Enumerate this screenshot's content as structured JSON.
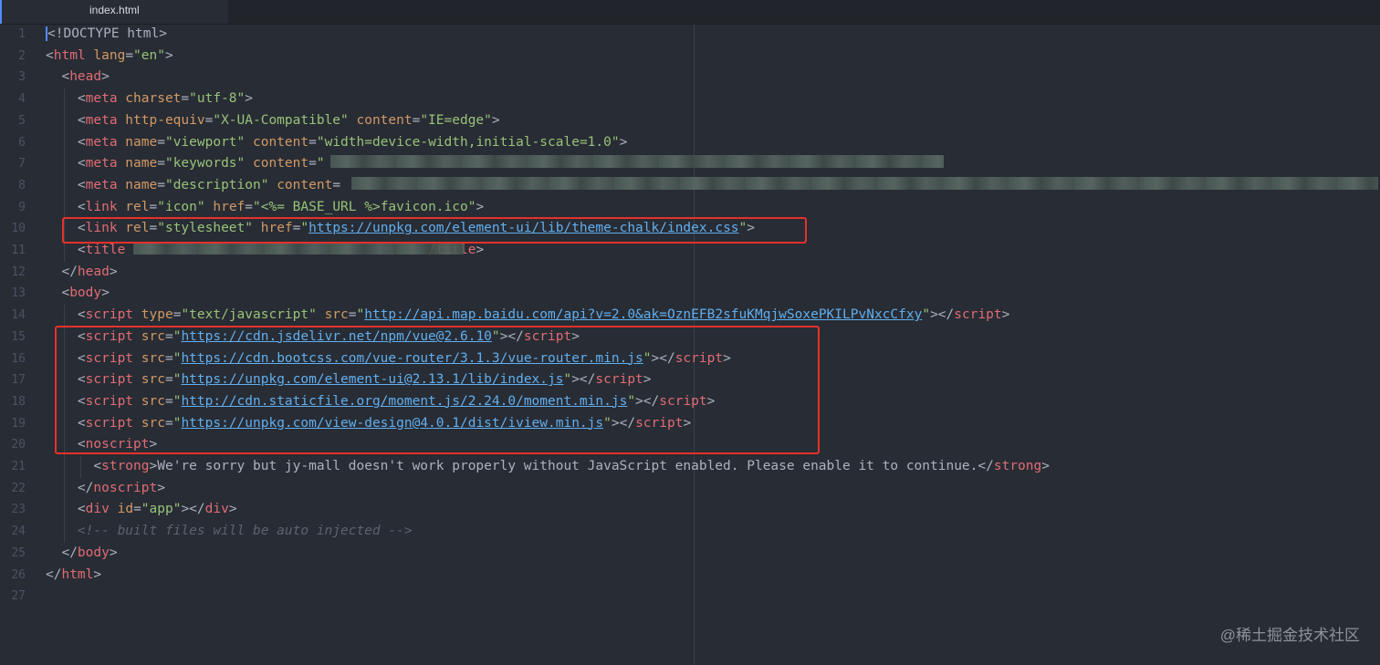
{
  "tab": {
    "filename": "index.html"
  },
  "lines": [
    {
      "n": "1",
      "tokens": [
        {
          "t": "<",
          "c": "t-punc t-cur"
        },
        {
          "t": "!DOCTYPE html",
          "c": "t-punc"
        },
        {
          "t": ">",
          "c": "t-punc"
        }
      ]
    },
    {
      "n": "2",
      "tokens": [
        {
          "t": "<",
          "c": "t-punc"
        },
        {
          "t": "html",
          "c": "t-tag"
        },
        {
          "t": " lang",
          "c": "t-attr"
        },
        {
          "t": "=",
          "c": "t-punc"
        },
        {
          "t": "\"en\"",
          "c": "t-str"
        },
        {
          "t": ">",
          "c": "t-punc"
        }
      ]
    },
    {
      "n": "3",
      "tokens": [
        {
          "t": "  <",
          "c": "t-punc"
        },
        {
          "t": "head",
          "c": "t-tag"
        },
        {
          "t": ">",
          "c": "t-punc"
        }
      ]
    },
    {
      "n": "4",
      "tokens": [
        {
          "t": "    <",
          "c": "t-punc"
        },
        {
          "t": "meta",
          "c": "t-tag"
        },
        {
          "t": " charset",
          "c": "t-attr"
        },
        {
          "t": "=",
          "c": "t-punc"
        },
        {
          "t": "\"utf-8\"",
          "c": "t-str"
        },
        {
          "t": ">",
          "c": "t-punc"
        }
      ]
    },
    {
      "n": "5",
      "tokens": [
        {
          "t": "    <",
          "c": "t-punc"
        },
        {
          "t": "meta",
          "c": "t-tag"
        },
        {
          "t": " http-equiv",
          "c": "t-attr"
        },
        {
          "t": "=",
          "c": "t-punc"
        },
        {
          "t": "\"X-UA-Compatible\"",
          "c": "t-str"
        },
        {
          "t": " content",
          "c": "t-attr"
        },
        {
          "t": "=",
          "c": "t-punc"
        },
        {
          "t": "\"IE=edge\"",
          "c": "t-str"
        },
        {
          "t": ">",
          "c": "t-punc"
        }
      ]
    },
    {
      "n": "6",
      "tokens": [
        {
          "t": "    <",
          "c": "t-punc"
        },
        {
          "t": "meta",
          "c": "t-tag"
        },
        {
          "t": " name",
          "c": "t-attr"
        },
        {
          "t": "=",
          "c": "t-punc"
        },
        {
          "t": "\"viewport\"",
          "c": "t-str"
        },
        {
          "t": " content",
          "c": "t-attr"
        },
        {
          "t": "=",
          "c": "t-punc"
        },
        {
          "t": "\"width=device-width,initial-scale=1.0\"",
          "c": "t-str"
        },
        {
          "t": ">",
          "c": "t-punc"
        }
      ]
    },
    {
      "n": "7",
      "tokens": [
        {
          "t": "    <",
          "c": "t-punc"
        },
        {
          "t": "meta",
          "c": "t-tag"
        },
        {
          "t": " name",
          "c": "t-attr"
        },
        {
          "t": "=",
          "c": "t-punc"
        },
        {
          "t": "\"keywords\"",
          "c": "t-str"
        },
        {
          "t": " content",
          "c": "t-attr"
        },
        {
          "t": "=",
          "c": "t-punc"
        },
        {
          "t": "\"",
          "c": "t-str"
        }
      ]
    },
    {
      "n": "8",
      "tokens": [
        {
          "t": "    <",
          "c": "t-punc"
        },
        {
          "t": "meta",
          "c": "t-tag"
        },
        {
          "t": " name",
          "c": "t-attr"
        },
        {
          "t": "=",
          "c": "t-punc"
        },
        {
          "t": "\"description\"",
          "c": "t-str"
        },
        {
          "t": " content",
          "c": "t-attr"
        },
        {
          "t": "=",
          "c": "t-punc"
        }
      ]
    },
    {
      "n": "9",
      "tokens": [
        {
          "t": "    <",
          "c": "t-punc"
        },
        {
          "t": "link",
          "c": "t-tag"
        },
        {
          "t": " rel",
          "c": "t-attr"
        },
        {
          "t": "=",
          "c": "t-punc"
        },
        {
          "t": "\"icon\"",
          "c": "t-str"
        },
        {
          "t": " href",
          "c": "t-attr"
        },
        {
          "t": "=",
          "c": "t-punc"
        },
        {
          "t": "\"<%= BASE_URL %>favicon.ico\"",
          "c": "t-str"
        },
        {
          "t": ">",
          "c": "t-punc"
        }
      ]
    },
    {
      "n": "10",
      "tokens": [
        {
          "t": "    <",
          "c": "t-punc"
        },
        {
          "t": "link",
          "c": "t-tag"
        },
        {
          "t": " rel",
          "c": "t-attr"
        },
        {
          "t": "=",
          "c": "t-punc"
        },
        {
          "t": "\"stylesheet\"",
          "c": "t-str"
        },
        {
          "t": " href",
          "c": "t-attr"
        },
        {
          "t": "=",
          "c": "t-punc"
        },
        {
          "t": "\"",
          "c": "t-str"
        },
        {
          "t": "https://unpkg.com/element-ui/lib/theme-chalk/index.css",
          "c": "t-link"
        },
        {
          "t": "\"",
          "c": "t-str"
        },
        {
          "t": ">",
          "c": "t-punc"
        }
      ]
    },
    {
      "n": "11",
      "tokens": [
        {
          "t": "    <",
          "c": "t-punc"
        },
        {
          "t": "title",
          "c": "t-tag"
        },
        {
          "t": "                                      ",
          "c": "t-punc"
        },
        {
          "t": "/title",
          "c": "t-tag"
        },
        {
          "t": ">",
          "c": "t-punc"
        }
      ]
    },
    {
      "n": "12",
      "tokens": [
        {
          "t": "  </",
          "c": "t-punc"
        },
        {
          "t": "head",
          "c": "t-tag"
        },
        {
          "t": ">",
          "c": "t-punc"
        }
      ]
    },
    {
      "n": "13",
      "tokens": [
        {
          "t": "  <",
          "c": "t-punc"
        },
        {
          "t": "body",
          "c": "t-tag"
        },
        {
          "t": ">",
          "c": "t-punc"
        }
      ]
    },
    {
      "n": "14",
      "tokens": [
        {
          "t": "    <",
          "c": "t-punc"
        },
        {
          "t": "script",
          "c": "t-tag"
        },
        {
          "t": " type",
          "c": "t-attr"
        },
        {
          "t": "=",
          "c": "t-punc"
        },
        {
          "t": "\"text/javascript\"",
          "c": "t-str"
        },
        {
          "t": " src",
          "c": "t-attr"
        },
        {
          "t": "=",
          "c": "t-punc"
        },
        {
          "t": "\"",
          "c": "t-str"
        },
        {
          "t": "http://api.map.baidu.com/api?v=2.0&ak=OznEFB2sfuKMqjwSoxePKILPvNxcCfxy",
          "c": "t-link"
        },
        {
          "t": "\"",
          "c": "t-str"
        },
        {
          "t": "></",
          "c": "t-punc"
        },
        {
          "t": "script",
          "c": "t-tag"
        },
        {
          "t": ">",
          "c": "t-punc"
        }
      ]
    },
    {
      "n": "15",
      "tokens": [
        {
          "t": "    <",
          "c": "t-punc"
        },
        {
          "t": "script",
          "c": "t-tag"
        },
        {
          "t": " src",
          "c": "t-attr"
        },
        {
          "t": "=",
          "c": "t-punc"
        },
        {
          "t": "\"",
          "c": "t-str"
        },
        {
          "t": "https://cdn.jsdelivr.net/npm/vue@2.6.10",
          "c": "t-link"
        },
        {
          "t": "\"",
          "c": "t-str"
        },
        {
          "t": "></",
          "c": "t-punc"
        },
        {
          "t": "script",
          "c": "t-tag"
        },
        {
          "t": ">",
          "c": "t-punc"
        }
      ]
    },
    {
      "n": "16",
      "tokens": [
        {
          "t": "    <",
          "c": "t-punc"
        },
        {
          "t": "script",
          "c": "t-tag"
        },
        {
          "t": " src",
          "c": "t-attr"
        },
        {
          "t": "=",
          "c": "t-punc"
        },
        {
          "t": "\"",
          "c": "t-str"
        },
        {
          "t": "https://cdn.bootcss.com/vue-router/3.1.3/vue-router.min.js",
          "c": "t-link"
        },
        {
          "t": "\"",
          "c": "t-str"
        },
        {
          "t": "></",
          "c": "t-punc"
        },
        {
          "t": "script",
          "c": "t-tag"
        },
        {
          "t": ">",
          "c": "t-punc"
        }
      ]
    },
    {
      "n": "17",
      "tokens": [
        {
          "t": "    <",
          "c": "t-punc"
        },
        {
          "t": "script",
          "c": "t-tag"
        },
        {
          "t": " src",
          "c": "t-attr"
        },
        {
          "t": "=",
          "c": "t-punc"
        },
        {
          "t": "\"",
          "c": "t-str"
        },
        {
          "t": "https://unpkg.com/element-ui@2.13.1/lib/index.js",
          "c": "t-link"
        },
        {
          "t": "\"",
          "c": "t-str"
        },
        {
          "t": "></",
          "c": "t-punc"
        },
        {
          "t": "script",
          "c": "t-tag"
        },
        {
          "t": ">",
          "c": "t-punc"
        }
      ]
    },
    {
      "n": "18",
      "tokens": [
        {
          "t": "    <",
          "c": "t-punc"
        },
        {
          "t": "script",
          "c": "t-tag"
        },
        {
          "t": " src",
          "c": "t-attr"
        },
        {
          "t": "=",
          "c": "t-punc"
        },
        {
          "t": "\"",
          "c": "t-str"
        },
        {
          "t": "http://cdn.staticfile.org/moment.js/2.24.0/moment.min.js",
          "c": "t-link"
        },
        {
          "t": "\"",
          "c": "t-str"
        },
        {
          "t": "></",
          "c": "t-punc"
        },
        {
          "t": "script",
          "c": "t-tag"
        },
        {
          "t": ">",
          "c": "t-punc"
        }
      ]
    },
    {
      "n": "19",
      "tokens": [
        {
          "t": "    <",
          "c": "t-punc"
        },
        {
          "t": "script",
          "c": "t-tag"
        },
        {
          "t": " src",
          "c": "t-attr"
        },
        {
          "t": "=",
          "c": "t-punc"
        },
        {
          "t": "\"",
          "c": "t-str"
        },
        {
          "t": "https://unpkg.com/view-design@4.0.1/dist/iview.min.js",
          "c": "t-link"
        },
        {
          "t": "\"",
          "c": "t-str"
        },
        {
          "t": "></",
          "c": "t-punc"
        },
        {
          "t": "script",
          "c": "t-tag"
        },
        {
          "t": ">",
          "c": "t-punc"
        }
      ]
    },
    {
      "n": "20",
      "tokens": [
        {
          "t": "    <",
          "c": "t-punc"
        },
        {
          "t": "noscript",
          "c": "t-tag"
        },
        {
          "t": ">",
          "c": "t-punc"
        }
      ]
    },
    {
      "n": "21",
      "tokens": [
        {
          "t": "      <",
          "c": "t-punc"
        },
        {
          "t": "strong",
          "c": "t-tag"
        },
        {
          "t": ">We're sorry but jy-mall doesn't work properly without JavaScript enabled. Please enable it to continue.</",
          "c": "t-punc"
        },
        {
          "t": "strong",
          "c": "t-tag"
        },
        {
          "t": ">",
          "c": "t-punc"
        }
      ]
    },
    {
      "n": "22",
      "tokens": [
        {
          "t": "    </",
          "c": "t-punc"
        },
        {
          "t": "noscript",
          "c": "t-tag"
        },
        {
          "t": ">",
          "c": "t-punc"
        }
      ]
    },
    {
      "n": "23",
      "tokens": [
        {
          "t": "    <",
          "c": "t-punc"
        },
        {
          "t": "div",
          "c": "t-tag"
        },
        {
          "t": " id",
          "c": "t-attr"
        },
        {
          "t": "=",
          "c": "t-punc"
        },
        {
          "t": "\"app\"",
          "c": "t-str"
        },
        {
          "t": "></",
          "c": "t-punc"
        },
        {
          "t": "div",
          "c": "t-tag"
        },
        {
          "t": ">",
          "c": "t-punc"
        }
      ]
    },
    {
      "n": "24",
      "tokens": [
        {
          "t": "    <!-- built files will be auto injected -->",
          "c": "t-cmt"
        }
      ]
    },
    {
      "n": "25",
      "tokens": [
        {
          "t": "  </",
          "c": "t-punc"
        },
        {
          "t": "body",
          "c": "t-tag"
        },
        {
          "t": ">",
          "c": "t-punc"
        }
      ]
    },
    {
      "n": "26",
      "tokens": [
        {
          "t": "</",
          "c": "t-punc"
        },
        {
          "t": "html",
          "c": "t-tag"
        },
        {
          "t": ">",
          "c": "t-punc"
        }
      ]
    },
    {
      "n": "27",
      "tokens": []
    }
  ],
  "watermark": "@稀土掘金技术社区",
  "colors": {
    "background": "#282c34",
    "highlight_box": "#e5312b",
    "tag": "#e06c75",
    "attribute": "#d19a66",
    "string": "#98c379",
    "link": "#61afef"
  }
}
